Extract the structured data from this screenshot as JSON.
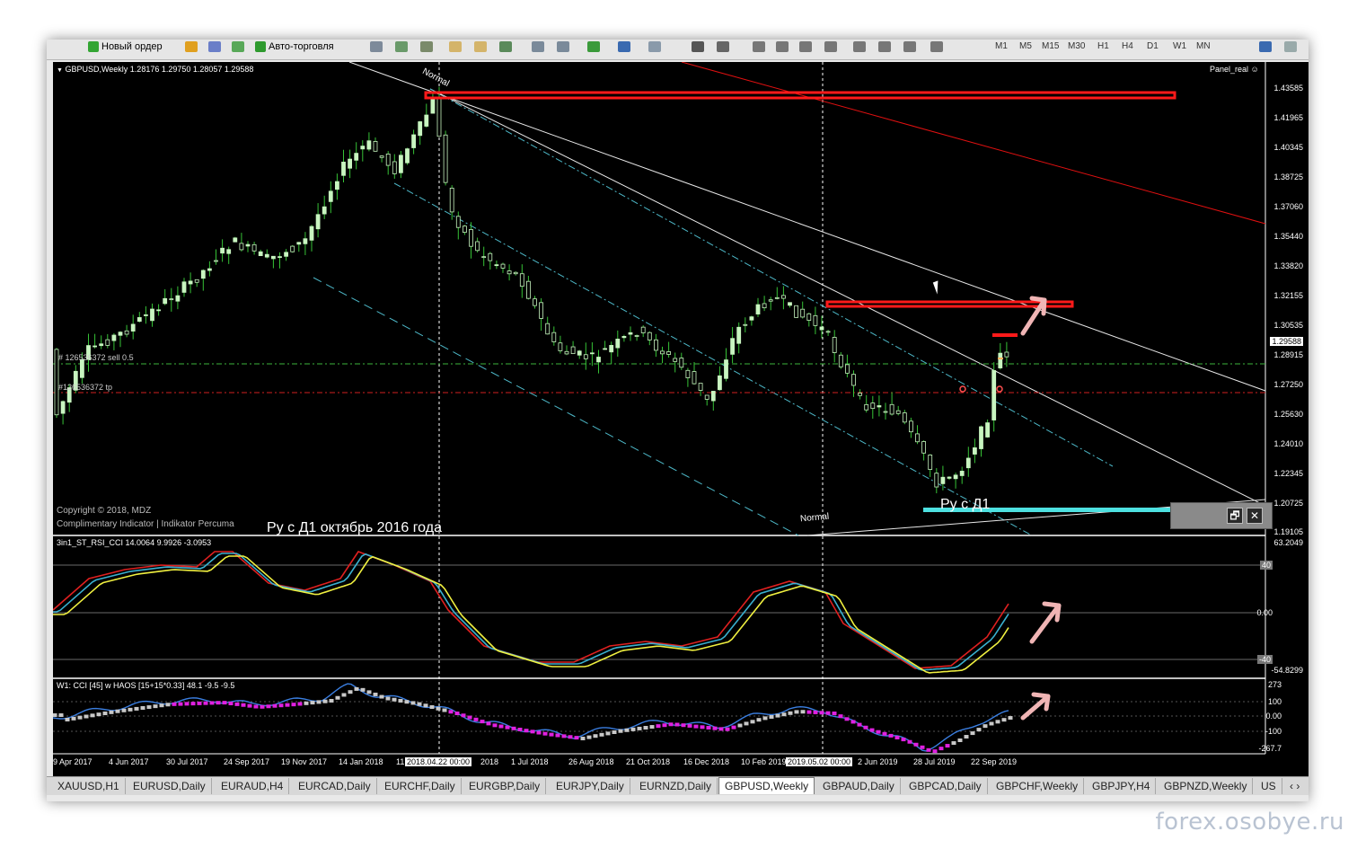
{
  "toolbar": {
    "new_order_label": "Новый ордер",
    "autotrading_label": "Авто-торговля",
    "timeframes": [
      "M1",
      "M5",
      "M15",
      "M30",
      "H1",
      "H4",
      "D1",
      "W1",
      "MN"
    ]
  },
  "main_chart": {
    "header": "GBPUSD,Weekly  1.28176 1.29750 1.28057 1.29588",
    "panel_label": "Panel_real",
    "current_price_label": "1.29588",
    "price_labels": [
      "1.43585",
      "1.41965",
      "1.40345",
      "1.38725",
      "1.37060",
      "1.35440",
      "1.33820",
      "1.32155",
      "1.30535",
      "1.28915",
      "1.27250",
      "1.25630",
      "1.24010",
      "1.22345",
      "1.20725",
      "1.19105"
    ],
    "order_sell_label": "# 126536372 sell 0.5",
    "order_tp_label": "#126536372 tp",
    "normal_label_top": "Normal",
    "normal_label_bottom": "Normal",
    "copyright_line1": "Copyright © 2018, MDZ",
    "copyright_line2": "Complimentary Indicator  |  Indikator Percuma",
    "annotation_bottom": "Ру с Д1 октябрь 2016 года",
    "annotation_right": "Ру с Д1"
  },
  "panel_box": {
    "restore_icon_label": "🗗",
    "close_icon_label": "✕"
  },
  "indicator1": {
    "header": "3in1_ST_RSI_CCI 14.0064 9.9926 -3.0953",
    "scale_labels": [
      "63.2049",
      "40",
      "0.00",
      "-40",
      "-54.8299"
    ]
  },
  "indicator2": {
    "header": "W1: CCI [45] w HAOS [15+15*0.33] 48.1 -9.5 -9.5",
    "scale_labels": [
      "273",
      "100",
      "0.00",
      "-100",
      "-267.7"
    ]
  },
  "time_axis": {
    "labels": [
      "9 Apr 2017",
      "4 Jun 2017",
      "30 Jul 2017",
      "24 Sep 2017",
      "19 Nov 2017",
      "14 Jan 2018",
      "11 Mar 2018",
      "2018.04.22 00:00",
      "2018",
      "1 Jul 2018",
      "26 Aug 2018",
      "21 Oct 2018",
      "16 Dec 2018",
      "10 Feb 2019",
      "2019.05.02 00:00",
      "2 Jun 2019",
      "28 Jul 2019",
      "22 Sep 2019"
    ]
  },
  "tabs": [
    "XAUUSD,H1",
    "EURUSD,Daily",
    "EURAUD,H4",
    "EURCAD,Daily",
    "EURCHF,Daily",
    "EURGBP,Daily",
    "EURJPY,Daily",
    "EURNZD,Daily",
    "GBPUSD,Weekly",
    "GBPAUD,Daily",
    "GBPCAD,Daily",
    "GBPCHF,Weekly",
    "GBPJPY,H4",
    "GBPNZD,Weekly",
    "US"
  ],
  "active_tab": "GBPUSD,Weekly",
  "watermark": "forex.osobye.ru",
  "colors": {
    "background": "#000000",
    "bull_candle": "#c8f5c0",
    "bear_candle": "#c8f5c0",
    "wick": "#36c236",
    "resistance": "#ff1a1a",
    "support": "#4de0e0",
    "arrow": "#f0b5b5",
    "sell_line": "#3cb43c",
    "tp_line": "#d02020"
  }
}
